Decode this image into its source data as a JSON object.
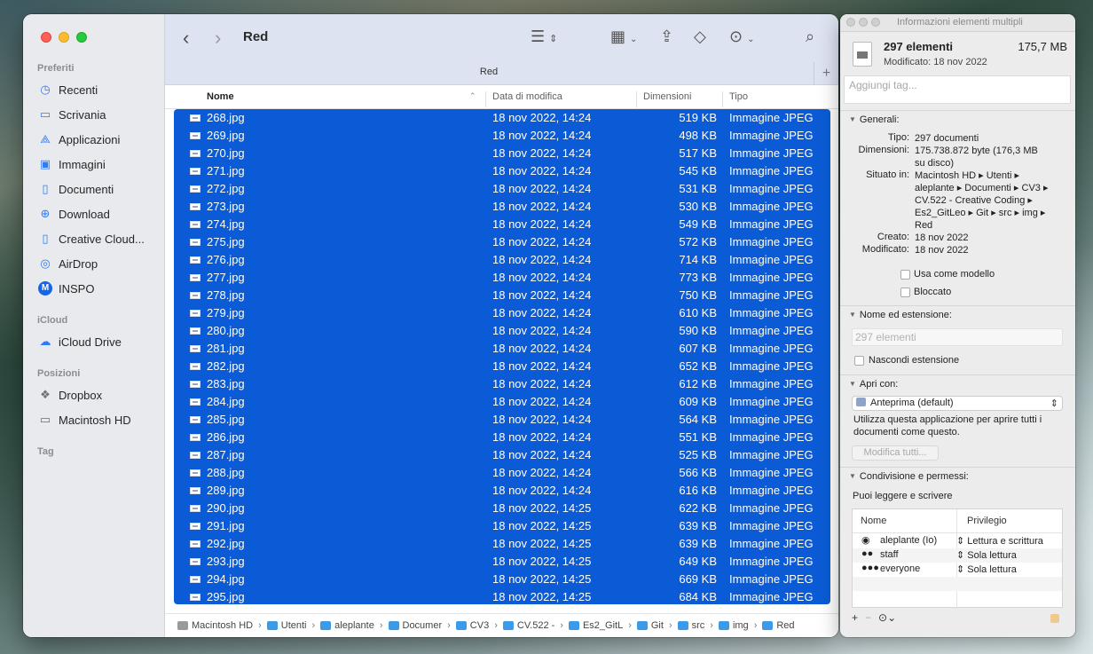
{
  "sidebar": {
    "sections": [
      {
        "title": "Preferiti",
        "items": [
          {
            "label": "Recenti",
            "icon": "clock-icon"
          },
          {
            "label": "Scrivania",
            "icon": "desktop-icon"
          },
          {
            "label": "Applicazioni",
            "icon": "applications-icon"
          },
          {
            "label": "Immagini",
            "icon": "photo-icon"
          },
          {
            "label": "Documenti",
            "icon": "document-icon"
          },
          {
            "label": "Download",
            "icon": "download-icon"
          },
          {
            "label": "Creative Cloud...",
            "icon": "file-icon"
          },
          {
            "label": "AirDrop",
            "icon": "airdrop-icon"
          },
          {
            "label": "INSPO",
            "icon": "inspo-app-icon"
          }
        ]
      },
      {
        "title": "iCloud",
        "items": [
          {
            "label": "iCloud Drive",
            "icon": "cloud-icon"
          }
        ]
      },
      {
        "title": "Posizioni",
        "items": [
          {
            "label": "Dropbox",
            "icon": "dropbox-icon"
          },
          {
            "label": "Macintosh HD",
            "icon": "harddisk-icon"
          }
        ]
      },
      {
        "title": "Tag",
        "items": []
      }
    ]
  },
  "toolbar": {
    "title": "Red",
    "tab_title": "Red"
  },
  "columns": {
    "name": "Nome",
    "date": "Data di modifica",
    "size": "Dimensioni",
    "type": "Tipo"
  },
  "files": [
    {
      "name": "268.jpg",
      "date": "18 nov 2022, 14:24",
      "size": "519 KB",
      "type": "Immagine JPEG"
    },
    {
      "name": "269.jpg",
      "date": "18 nov 2022, 14:24",
      "size": "498 KB",
      "type": "Immagine JPEG"
    },
    {
      "name": "270.jpg",
      "date": "18 nov 2022, 14:24",
      "size": "517 KB",
      "type": "Immagine JPEG"
    },
    {
      "name": "271.jpg",
      "date": "18 nov 2022, 14:24",
      "size": "545 KB",
      "type": "Immagine JPEG"
    },
    {
      "name": "272.jpg",
      "date": "18 nov 2022, 14:24",
      "size": "531 KB",
      "type": "Immagine JPEG"
    },
    {
      "name": "273.jpg",
      "date": "18 nov 2022, 14:24",
      "size": "530 KB",
      "type": "Immagine JPEG"
    },
    {
      "name": "274.jpg",
      "date": "18 nov 2022, 14:24",
      "size": "549 KB",
      "type": "Immagine JPEG"
    },
    {
      "name": "275.jpg",
      "date": "18 nov 2022, 14:24",
      "size": "572 KB",
      "type": "Immagine JPEG"
    },
    {
      "name": "276.jpg",
      "date": "18 nov 2022, 14:24",
      "size": "714 KB",
      "type": "Immagine JPEG"
    },
    {
      "name": "277.jpg",
      "date": "18 nov 2022, 14:24",
      "size": "773 KB",
      "type": "Immagine JPEG"
    },
    {
      "name": "278.jpg",
      "date": "18 nov 2022, 14:24",
      "size": "750 KB",
      "type": "Immagine JPEG"
    },
    {
      "name": "279.jpg",
      "date": "18 nov 2022, 14:24",
      "size": "610 KB",
      "type": "Immagine JPEG"
    },
    {
      "name": "280.jpg",
      "date": "18 nov 2022, 14:24",
      "size": "590 KB",
      "type": "Immagine JPEG"
    },
    {
      "name": "281.jpg",
      "date": "18 nov 2022, 14:24",
      "size": "607 KB",
      "type": "Immagine JPEG"
    },
    {
      "name": "282.jpg",
      "date": "18 nov 2022, 14:24",
      "size": "652 KB",
      "type": "Immagine JPEG"
    },
    {
      "name": "283.jpg",
      "date": "18 nov 2022, 14:24",
      "size": "612 KB",
      "type": "Immagine JPEG"
    },
    {
      "name": "284.jpg",
      "date": "18 nov 2022, 14:24",
      "size": "609 KB",
      "type": "Immagine JPEG"
    },
    {
      "name": "285.jpg",
      "date": "18 nov 2022, 14:24",
      "size": "564 KB",
      "type": "Immagine JPEG"
    },
    {
      "name": "286.jpg",
      "date": "18 nov 2022, 14:24",
      "size": "551 KB",
      "type": "Immagine JPEG"
    },
    {
      "name": "287.jpg",
      "date": "18 nov 2022, 14:24",
      "size": "525 KB",
      "type": "Immagine JPEG"
    },
    {
      "name": "288.jpg",
      "date": "18 nov 2022, 14:24",
      "size": "566 KB",
      "type": "Immagine JPEG"
    },
    {
      "name": "289.jpg",
      "date": "18 nov 2022, 14:24",
      "size": "616 KB",
      "type": "Immagine JPEG"
    },
    {
      "name": "290.jpg",
      "date": "18 nov 2022, 14:25",
      "size": "622 KB",
      "type": "Immagine JPEG"
    },
    {
      "name": "291.jpg",
      "date": "18 nov 2022, 14:25",
      "size": "639 KB",
      "type": "Immagine JPEG"
    },
    {
      "name": "292.jpg",
      "date": "18 nov 2022, 14:25",
      "size": "639 KB",
      "type": "Immagine JPEG"
    },
    {
      "name": "293.jpg",
      "date": "18 nov 2022, 14:25",
      "size": "649 KB",
      "type": "Immagine JPEG"
    },
    {
      "name": "294.jpg",
      "date": "18 nov 2022, 14:25",
      "size": "669 KB",
      "type": "Immagine JPEG"
    },
    {
      "name": "295.jpg",
      "date": "18 nov 2022, 14:25",
      "size": "684 KB",
      "type": "Immagine JPEG"
    }
  ],
  "pathbar": [
    {
      "label": "Macintosh HD",
      "kind": "disk"
    },
    {
      "label": "Utenti",
      "kind": "folder"
    },
    {
      "label": "aleplante",
      "kind": "folder"
    },
    {
      "label": "Documer",
      "kind": "folder"
    },
    {
      "label": "CV3",
      "kind": "folder"
    },
    {
      "label": "CV.522 -",
      "kind": "folder"
    },
    {
      "label": "Es2_GitL",
      "kind": "folder"
    },
    {
      "label": "Git",
      "kind": "folder"
    },
    {
      "label": "src",
      "kind": "folder"
    },
    {
      "label": "img",
      "kind": "folder"
    },
    {
      "label": "Red",
      "kind": "folder"
    }
  ],
  "info": {
    "window_title": "Informazioni elementi multipli",
    "count": "297 elementi",
    "total_size": "175,7 MB",
    "modified_header": "Modificato: 18 nov 2022",
    "tag_placeholder": "Aggiungi tag...",
    "general": {
      "title": "Generali:",
      "tipo_k": "Tipo:",
      "tipo_v": "297 documenti",
      "dim_k": "Dimensioni:",
      "dim_v1": "175.738.872 byte (176,3 MB",
      "dim_v2": "su disco)",
      "sit_k": "Situato in:",
      "sit_lines": [
        "Macintosh HD ▸ Utenti ▸",
        "aleplante ▸ Documenti ▸ CV3 ▸",
        "CV.522 - Creative Coding ▸",
        "Es2_GitLeo ▸ Git ▸ src ▸ img ▸",
        "Red"
      ],
      "creato_k": "Creato:",
      "creato_v": "18 nov 2022",
      "modif_k": "Modificato:",
      "modif_v": "18 nov 2022",
      "template_label": "Usa come modello",
      "locked_label": "Bloccato"
    },
    "name_section": {
      "title": "Nome ed estensione:",
      "name_placeholder": "297 elementi",
      "hide_ext_label": "Nascondi estensione"
    },
    "open_with": {
      "title": "Apri con:",
      "app": "Anteprima (default)",
      "description_1": "Utilizza questa applicazione per aprire tutti i",
      "description_2": "documenti come questo.",
      "change_all": "Modifica tutti..."
    },
    "sharing": {
      "title": "Condivisione e permessi:",
      "subtitle": "Puoi leggere e scrivere",
      "col_name": "Nome",
      "col_priv": "Privilegio",
      "rows": [
        {
          "name": "aleplante (Io)",
          "priv": "Lettura e scrittura",
          "icon": "user-icon"
        },
        {
          "name": "staff",
          "priv": "Sola lettura",
          "icon": "group-icon"
        },
        {
          "name": "everyone",
          "priv": "Sola lettura",
          "icon": "everyone-icon"
        }
      ]
    }
  }
}
